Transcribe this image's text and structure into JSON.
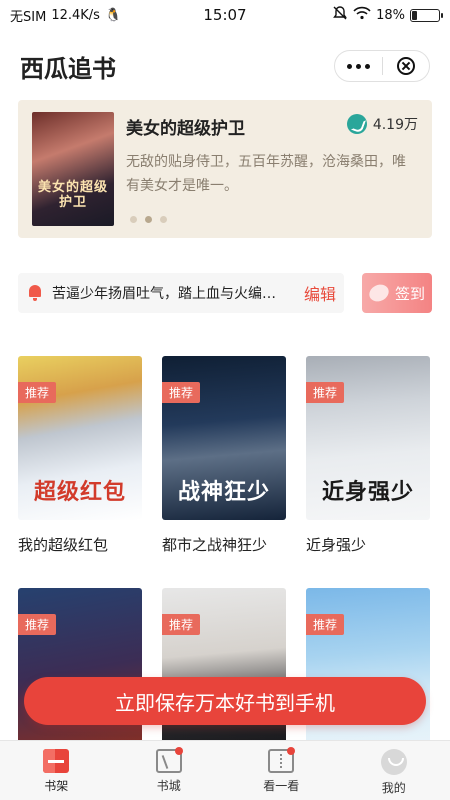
{
  "status_bar": {
    "carrier": "无SIM",
    "speed": "12.4K/s",
    "time": "15:07",
    "battery": "18%",
    "battery_level": 0.18
  },
  "header": {
    "title": "西瓜追书"
  },
  "featured": {
    "title": "美女的超级护卫",
    "badge": "4.19万",
    "description": "无敌的贴身侍卫，五百年苏醒，沧海桑田，唯有美女才是唯一。",
    "cover_text": "美女的超级护卫",
    "page_count": 3,
    "active_page": 1
  },
  "notice": {
    "text": "苦逼少年扬眉吐气，踏上血与火编…",
    "edit_label": "编辑"
  },
  "checkin": {
    "label": "签到"
  },
  "books": [
    {
      "tag": "推荐",
      "name": "我的超级红包",
      "cover_text": "超级红包"
    },
    {
      "tag": "推荐",
      "name": "都市之战神狂少",
      "cover_text": "战神狂少"
    },
    {
      "tag": "推荐",
      "name": "近身强少",
      "cover_text": "近身强少"
    },
    {
      "tag": "推荐",
      "name": "",
      "cover_text": ""
    },
    {
      "tag": "推荐",
      "name": "",
      "cover_text": ""
    },
    {
      "tag": "推荐",
      "name": "",
      "cover_text": ""
    }
  ],
  "cta": {
    "label": "立即保存万本好书到手机"
  },
  "tabbar": {
    "items": [
      {
        "label": "书架",
        "icon": "bookshelf-icon",
        "active": true,
        "dot": false
      },
      {
        "label": "书城",
        "icon": "bookstore-icon",
        "active": false,
        "dot": true
      },
      {
        "label": "看一看",
        "icon": "discover-icon",
        "active": false,
        "dot": true
      },
      {
        "label": "我的",
        "icon": "profile-icon",
        "active": false,
        "dot": false
      }
    ]
  },
  "colors": {
    "accent": "#e8443b",
    "banner_bg": "#f3ede2",
    "tag": "#e86a5c"
  }
}
